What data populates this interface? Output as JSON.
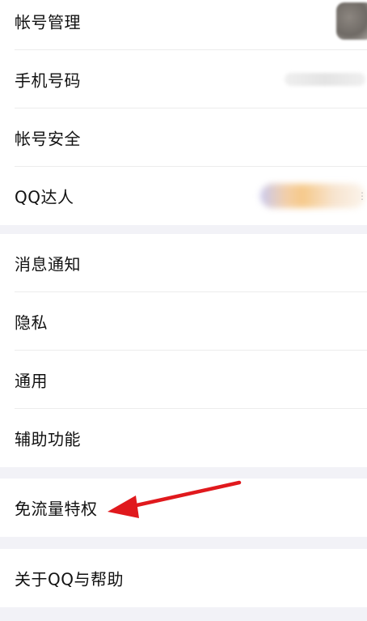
{
  "groups": [
    {
      "items": [
        {
          "label": "帐号管理"
        },
        {
          "label": "手机号码"
        },
        {
          "label": "帐号安全"
        },
        {
          "label": "QQ达人"
        }
      ]
    },
    {
      "items": [
        {
          "label": "消息通知"
        },
        {
          "label": "隐私"
        },
        {
          "label": "通用"
        },
        {
          "label": "辅助功能"
        }
      ]
    },
    {
      "items": [
        {
          "label": "免流量特权"
        }
      ]
    },
    {
      "items": [
        {
          "label": "关于QQ与帮助"
        }
      ]
    }
  ],
  "annotation": {
    "arrow_color": "#e0191d"
  }
}
